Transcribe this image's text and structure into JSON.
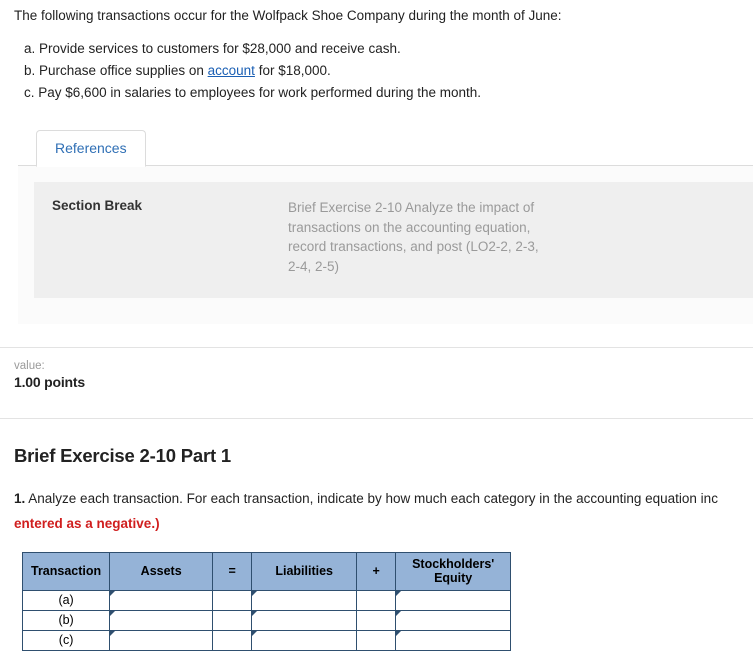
{
  "intro": {
    "lead": "The following transactions occur for the Wolfpack Shoe Company during the month of June:",
    "transactions": [
      {
        "prefix": "a.",
        "text_before": "Provide services to customers for $28,000 and receive cash.",
        "link": "",
        "text_after": ""
      },
      {
        "prefix": "b.",
        "text_before": "Purchase office supplies on ",
        "link": "account",
        "text_after": " for $18,000."
      },
      {
        "prefix": "c.",
        "text_before": "Pay $6,600 in salaries to employees for work performed during the month.",
        "link": "",
        "text_after": ""
      }
    ]
  },
  "references": {
    "tab_label": "References",
    "section_break_label": "Section Break",
    "section_break_description": "Brief Exercise 2-10 Analyze the impact of transactions on the accounting equation, record transactions, and post (LO2-2, 2-3, 2-4, 2-5)"
  },
  "value_bar": {
    "label": "value:",
    "points": "1.00 points"
  },
  "part": {
    "title": "Brief Exercise 2-10 Part 1",
    "question_number": "1.",
    "question_text": "Analyze each transaction. For each transaction, indicate by how much each category in the accounting equation inc",
    "question_emphasis": "entered as a negative.)"
  },
  "table": {
    "headers": [
      "Transaction",
      "Assets",
      "=",
      "Liabilities",
      "+",
      "Stockholders' Equity"
    ],
    "header_se_line1": "Stockholders'",
    "header_se_line2": "Equity",
    "rows": [
      {
        "label": "(a)",
        "assets": "",
        "liabilities": "",
        "equity": ""
      },
      {
        "label": "(b)",
        "assets": "",
        "liabilities": "",
        "equity": ""
      },
      {
        "label": "(c)",
        "assets": "",
        "liabilities": "",
        "equity": ""
      }
    ],
    "header_bg": "#95b3d7",
    "border_color": "#2f4f6f"
  }
}
